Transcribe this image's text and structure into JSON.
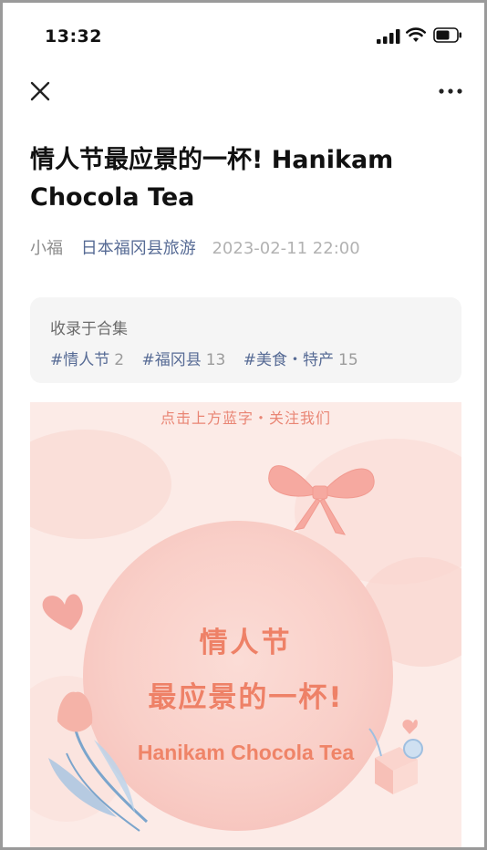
{
  "status_bar": {
    "time": "13:32"
  },
  "article": {
    "title": "情人节最应景的一杯! Hanikam Chocola Tea",
    "author": "小福",
    "account": "日本福冈县旅游",
    "date": "2023-02-11 22:00"
  },
  "collection": {
    "title": "收录于合集",
    "tags": [
      {
        "label": "#情人节",
        "count": "2"
      },
      {
        "label": "#福冈县",
        "count": "13"
      },
      {
        "label": "#美食・特产",
        "count": "15"
      }
    ]
  },
  "banner": {
    "top_text": "点击上方蓝字・关注我们",
    "line1": "情人节",
    "line2": "最应景的一杯!",
    "line3": "Hanikam Chocola Tea"
  },
  "icons": {
    "close": "close-icon",
    "more": "more-icon",
    "signal": "signal-icon",
    "wifi": "wifi-icon",
    "battery": "battery-icon"
  },
  "colors": {
    "link": "#576b95",
    "banner_bg": "#fcebe7",
    "banner_text": "#ee8167"
  }
}
